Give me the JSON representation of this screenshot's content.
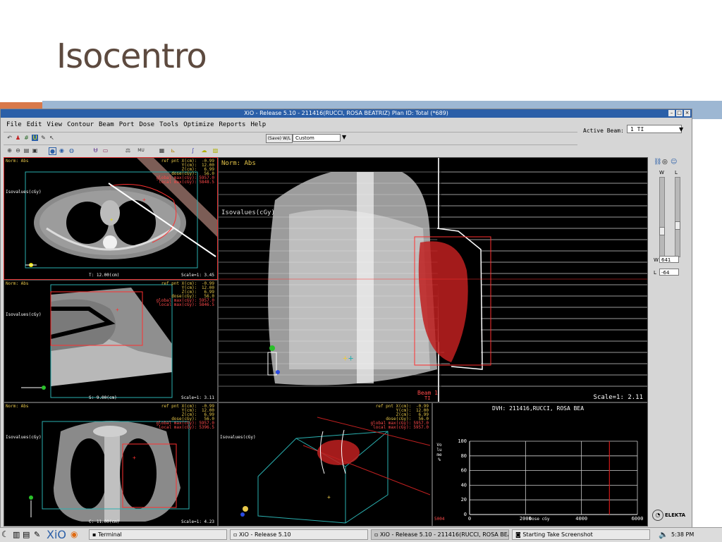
{
  "slide": {
    "title": "Isocentro"
  },
  "window": {
    "title": "XiO - Release 5.10 - 211416(RUCCI, ROSA BEATRIZ) Plan ID: Total (*689)"
  },
  "menu": [
    "File",
    "Edit",
    "View",
    "Contour",
    "Beam",
    "Port",
    "Dose",
    "Tools",
    "Optimize",
    "Reports",
    "Help"
  ],
  "toolbar": {
    "save_wl": "(Save) W/L",
    "preset": "Custom",
    "mu_label": "MU"
  },
  "active_beam": {
    "label": "Active Beam:",
    "value": "1 TI"
  },
  "panels": {
    "axial": {
      "norm": "Norm: Abs",
      "isovalues": "Isovalues(cGy)",
      "info_labels": [
        "ref pnt X(cm):",
        "Y(cm):",
        "Z(cm):",
        "dose(cGy):",
        "global max(cGy):",
        "local max(cGy):"
      ],
      "info_values": [
        "-0.99",
        "12.00",
        "6.99",
        "56.0",
        "5957.0",
        "5848.5"
      ],
      "slice": "T:  12.00(cm)",
      "scale": "Scale=1: 3.45"
    },
    "sagittal": {
      "norm": "Norm: Abs",
      "isovalues": "Isovalues(cGy)",
      "info_labels": [
        "ref pnt X(cm):",
        "Y(cm):",
        "Z(cm):",
        "dose(cGy):",
        "global max(cGy):",
        "local max(cGy):"
      ],
      "info_values": [
        "-0.99",
        "12.00",
        "6.99",
        "56.0",
        "5957.0",
        "5846.5"
      ],
      "slice": "S:  9.00(cm)",
      "scale": "Scale=1: 3.11"
    },
    "bev": {
      "norm": "Norm: Abs",
      "isovalues": "Isovalues(cGy)",
      "beam": "Beam 1",
      "beam_sub": "TI",
      "scale": "Scale=1: 2.11"
    },
    "coronal": {
      "norm": "Norm: Abs",
      "isovalues": "Isovalues(cGy)",
      "info_labels": [
        "ref pnt X(cm):",
        "Y(cm):",
        "Z(cm):",
        "dose(cGy):",
        "global max(cGy):",
        "local max(cGy):"
      ],
      "info_values": [
        "-0.99",
        "12.00",
        "6.99",
        "56.0",
        "5957.0",
        "5396.5"
      ],
      "slice": "C:  11.00(cm)",
      "scale": "Scale=1: 4.23"
    },
    "view3d": {
      "isovalues": "Isovalues(cGy)",
      "info_labels": [
        "ref pnt X(cm):",
        "Y(cm):",
        "Z(cm):",
        "dose(cGy):",
        "global max(cGy):",
        "local max(cGy):"
      ],
      "info_values": [
        "-0.99",
        "12.00",
        "6.99",
        "56.0",
        "5957.0",
        "5957.0"
      ]
    },
    "dvh": {
      "title": "DVH: 211416,RUCCI, ROSA BEA",
      "corner": "5004"
    }
  },
  "chart_data": {
    "type": "line",
    "title": "DVH: 211416,RUCCI, ROSA BEA",
    "xlabel": "Dose cGy",
    "ylabel": "Volume %",
    "x_ticks": [
      "0",
      "2000",
      "4000",
      "6000"
    ],
    "y_ticks": [
      "0",
      "20",
      "40",
      "60",
      "80",
      "100"
    ],
    "xlim": [
      0,
      6000
    ],
    "ylim": [
      0,
      100
    ],
    "grid": true,
    "series": [
      {
        "color": "#d01818",
        "x": [
          5000,
          5000
        ],
        "y": [
          0,
          100
        ]
      }
    ]
  },
  "wl": {
    "w_label": "W",
    "l_label": "L",
    "w_value": "641",
    "l_value": "-64"
  },
  "elekta": "ELEKTA",
  "taskbar": {
    "xio_logo": "XiO",
    "tasks": [
      "Terminal",
      "XiO - Release 5.10",
      "XiO - Release 5.10 - 211416(RUCCI, ROSA BEATRIZ) ...",
      "Starting Take Screenshot"
    ],
    "clock": "5:38 PM"
  },
  "colors": {
    "titlebar": "#2b5fa8",
    "panel_border": "#e03030",
    "accent_red": "#d01818",
    "label_yellow": "#e8c84a"
  }
}
